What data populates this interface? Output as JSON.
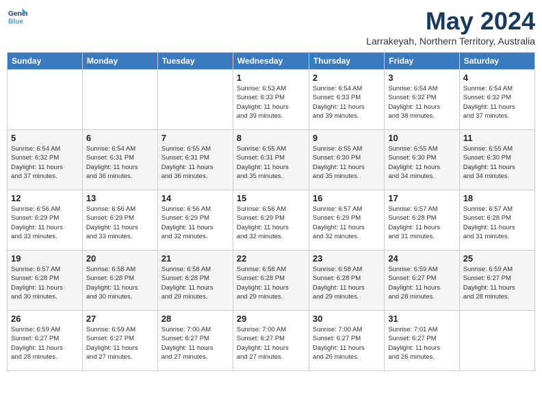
{
  "header": {
    "logo_line1": "General",
    "logo_line2": "Blue",
    "month_title": "May 2024",
    "location": "Larrakeyah, Northern Territory, Australia"
  },
  "weekdays": [
    "Sunday",
    "Monday",
    "Tuesday",
    "Wednesday",
    "Thursday",
    "Friday",
    "Saturday"
  ],
  "weeks": [
    [
      {
        "day": "",
        "info": ""
      },
      {
        "day": "",
        "info": ""
      },
      {
        "day": "",
        "info": ""
      },
      {
        "day": "1",
        "info": "Sunrise: 6:53 AM\nSunset: 6:33 PM\nDaylight: 11 hours\nand 39 minutes."
      },
      {
        "day": "2",
        "info": "Sunrise: 6:54 AM\nSunset: 6:33 PM\nDaylight: 11 hours\nand 39 minutes."
      },
      {
        "day": "3",
        "info": "Sunrise: 6:54 AM\nSunset: 6:32 PM\nDaylight: 11 hours\nand 38 minutes."
      },
      {
        "day": "4",
        "info": "Sunrise: 6:54 AM\nSunset: 6:32 PM\nDaylight: 11 hours\nand 37 minutes."
      }
    ],
    [
      {
        "day": "5",
        "info": "Sunrise: 6:54 AM\nSunset: 6:32 PM\nDaylight: 11 hours\nand 37 minutes."
      },
      {
        "day": "6",
        "info": "Sunrise: 6:54 AM\nSunset: 6:31 PM\nDaylight: 11 hours\nand 36 minutes."
      },
      {
        "day": "7",
        "info": "Sunrise: 6:55 AM\nSunset: 6:31 PM\nDaylight: 11 hours\nand 36 minutes."
      },
      {
        "day": "8",
        "info": "Sunrise: 6:55 AM\nSunset: 6:31 PM\nDaylight: 11 hours\nand 35 minutes."
      },
      {
        "day": "9",
        "info": "Sunrise: 6:55 AM\nSunset: 6:30 PM\nDaylight: 11 hours\nand 35 minutes."
      },
      {
        "day": "10",
        "info": "Sunrise: 6:55 AM\nSunset: 6:30 PM\nDaylight: 11 hours\nand 34 minutes."
      },
      {
        "day": "11",
        "info": "Sunrise: 6:55 AM\nSunset: 6:30 PM\nDaylight: 11 hours\nand 34 minutes."
      }
    ],
    [
      {
        "day": "12",
        "info": "Sunrise: 6:56 AM\nSunset: 6:29 PM\nDaylight: 11 hours\nand 33 minutes."
      },
      {
        "day": "13",
        "info": "Sunrise: 6:56 AM\nSunset: 6:29 PM\nDaylight: 11 hours\nand 33 minutes."
      },
      {
        "day": "14",
        "info": "Sunrise: 6:56 AM\nSunset: 6:29 PM\nDaylight: 11 hours\nand 32 minutes."
      },
      {
        "day": "15",
        "info": "Sunrise: 6:56 AM\nSunset: 6:29 PM\nDaylight: 11 hours\nand 32 minutes."
      },
      {
        "day": "16",
        "info": "Sunrise: 6:57 AM\nSunset: 6:29 PM\nDaylight: 11 hours\nand 32 minutes."
      },
      {
        "day": "17",
        "info": "Sunrise: 6:57 AM\nSunset: 6:28 PM\nDaylight: 11 hours\nand 31 minutes."
      },
      {
        "day": "18",
        "info": "Sunrise: 6:57 AM\nSunset: 6:28 PM\nDaylight: 11 hours\nand 31 minutes."
      }
    ],
    [
      {
        "day": "19",
        "info": "Sunrise: 6:57 AM\nSunset: 6:28 PM\nDaylight: 11 hours\nand 30 minutes."
      },
      {
        "day": "20",
        "info": "Sunrise: 6:58 AM\nSunset: 6:28 PM\nDaylight: 11 hours\nand 30 minutes."
      },
      {
        "day": "21",
        "info": "Sunrise: 6:58 AM\nSunset: 6:28 PM\nDaylight: 11 hours\nand 29 minutes."
      },
      {
        "day": "22",
        "info": "Sunrise: 6:58 AM\nSunset: 6:28 PM\nDaylight: 11 hours\nand 29 minutes."
      },
      {
        "day": "23",
        "info": "Sunrise: 6:58 AM\nSunset: 6:28 PM\nDaylight: 11 hours\nand 29 minutes."
      },
      {
        "day": "24",
        "info": "Sunrise: 6:59 AM\nSunset: 6:27 PM\nDaylight: 11 hours\nand 28 minutes."
      },
      {
        "day": "25",
        "info": "Sunrise: 6:59 AM\nSunset: 6:27 PM\nDaylight: 11 hours\nand 28 minutes."
      }
    ],
    [
      {
        "day": "26",
        "info": "Sunrise: 6:59 AM\nSunset: 6:27 PM\nDaylight: 11 hours\nand 28 minutes."
      },
      {
        "day": "27",
        "info": "Sunrise: 6:59 AM\nSunset: 6:27 PM\nDaylight: 11 hours\nand 27 minutes."
      },
      {
        "day": "28",
        "info": "Sunrise: 7:00 AM\nSunset: 6:27 PM\nDaylight: 11 hours\nand 27 minutes."
      },
      {
        "day": "29",
        "info": "Sunrise: 7:00 AM\nSunset: 6:27 PM\nDaylight: 11 hours\nand 27 minutes."
      },
      {
        "day": "30",
        "info": "Sunrise: 7:00 AM\nSunset: 6:27 PM\nDaylight: 11 hours\nand 26 minutes."
      },
      {
        "day": "31",
        "info": "Sunrise: 7:01 AM\nSunset: 6:27 PM\nDaylight: 11 hours\nand 26 minutes."
      },
      {
        "day": "",
        "info": ""
      }
    ]
  ]
}
